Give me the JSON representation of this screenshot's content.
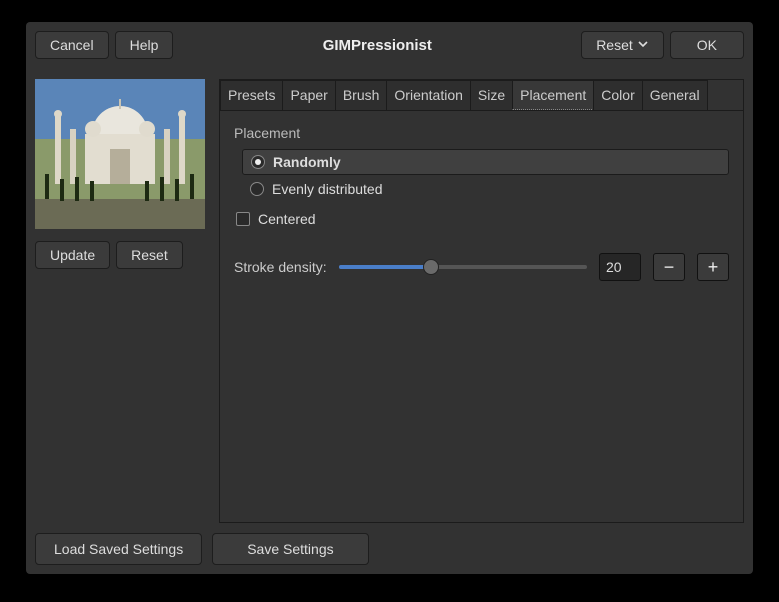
{
  "titlebar": {
    "cancel": "Cancel",
    "help": "Help",
    "title": "GIMPressionist",
    "reset": "Reset",
    "ok": "OK"
  },
  "preview": {
    "update": "Update",
    "reset": "Reset"
  },
  "tabs": [
    "Presets",
    "Paper",
    "Brush",
    "Orientation",
    "Size",
    "Placement",
    "Color",
    "General"
  ],
  "active_tab": "Placement",
  "placement": {
    "heading": "Placement",
    "radio_randomly": "Randomly",
    "radio_evenly": "Evenly distributed",
    "centered": "Centered",
    "stroke_density_label": "Stroke density:",
    "stroke_density_value": "20"
  },
  "footer": {
    "load": "Load Saved Settings",
    "save": "Save Settings"
  }
}
